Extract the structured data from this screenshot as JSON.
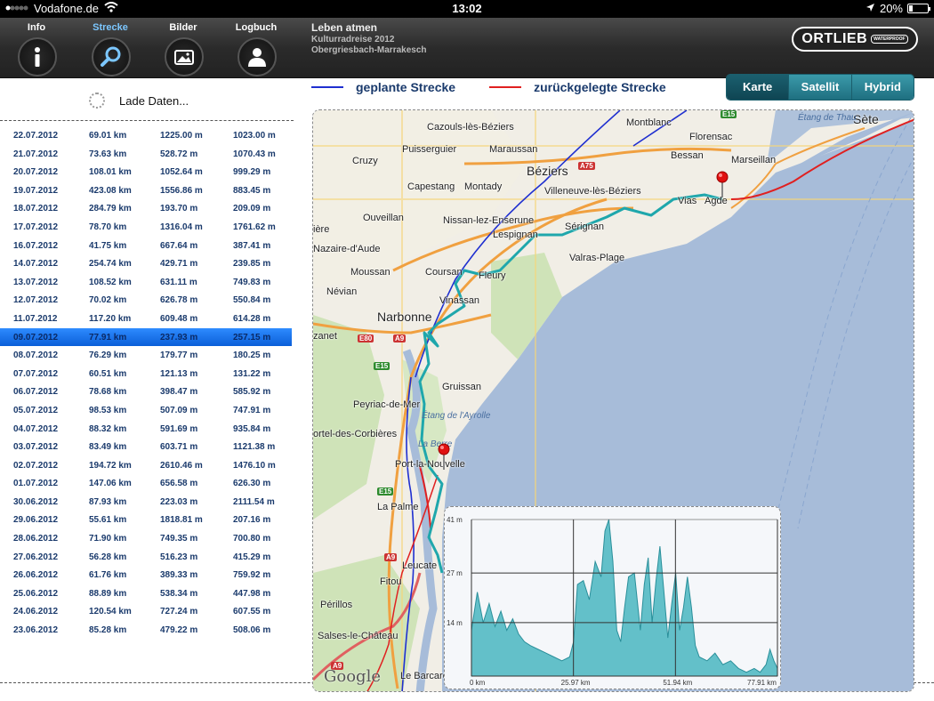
{
  "statusbar": {
    "carrier": "Vodafone.de",
    "time": "13:02",
    "battery": "20%",
    "battery_level": 0.2
  },
  "nav": {
    "tabs": [
      {
        "label": "Info",
        "icon": "info-icon",
        "active": false
      },
      {
        "label": "Strecke",
        "icon": "search-icon",
        "active": true
      },
      {
        "label": "Bilder",
        "icon": "photo-icon",
        "active": false
      },
      {
        "label": "Logbuch",
        "icon": "person-icon",
        "active": false
      }
    ]
  },
  "trip": {
    "title": "Leben atmen",
    "subtitle": "Kulturradreise 2012",
    "route": "Obergriesbach-Marrakesch"
  },
  "logo": {
    "brand": "ORTLIEB",
    "sub": "WATERPROOF"
  },
  "loading": "Lade Daten...",
  "legend": {
    "planned": {
      "label": "geplante Strecke",
      "color": "#1f2fd0"
    },
    "done": {
      "label": "zurückgelegte Strecke",
      "color": "#e02020"
    }
  },
  "maptype": {
    "options": [
      "Karte",
      "Satellit",
      "Hybrid"
    ],
    "selected": "Karte"
  },
  "days": [
    {
      "date": "22.07.2012",
      "dist": "69.01 km",
      "up": "1225.00 m",
      "down": "1023.00 m"
    },
    {
      "date": "21.07.2012",
      "dist": "73.63 km",
      "up": "528.72 m",
      "down": "1070.43 m"
    },
    {
      "date": "20.07.2012",
      "dist": "108.01 km",
      "up": "1052.64 m",
      "down": "999.29 m"
    },
    {
      "date": "19.07.2012",
      "dist": "423.08 km",
      "up": "1556.86 m",
      "down": "883.45 m"
    },
    {
      "date": "18.07.2012",
      "dist": "284.79 km",
      "up": "193.70 m",
      "down": "209.09 m"
    },
    {
      "date": "17.07.2012",
      "dist": "78.70 km",
      "up": "1316.04 m",
      "down": "1761.62 m"
    },
    {
      "date": "16.07.2012",
      "dist": "41.75 km",
      "up": "667.64 m",
      "down": "387.41 m"
    },
    {
      "date": "14.07.2012",
      "dist": "254.74 km",
      "up": "429.71 m",
      "down": "239.85 m"
    },
    {
      "date": "13.07.2012",
      "dist": "108.52 km",
      "up": "631.11 m",
      "down": "749.83 m"
    },
    {
      "date": "12.07.2012",
      "dist": "70.02 km",
      "up": "626.78 m",
      "down": "550.84 m"
    },
    {
      "date": "11.07.2012",
      "dist": "117.20 km",
      "up": "609.48 m",
      "down": "614.28 m"
    },
    {
      "date": "09.07.2012",
      "dist": "77.91 km",
      "up": "237.93 m",
      "down": "257.15 m",
      "selected": true
    },
    {
      "date": "08.07.2012",
      "dist": "76.29 km",
      "up": "179.77 m",
      "down": "180.25 m"
    },
    {
      "date": "07.07.2012",
      "dist": "60.51 km",
      "up": "121.13 m",
      "down": "131.22 m"
    },
    {
      "date": "06.07.2012",
      "dist": "78.68 km",
      "up": "398.47 m",
      "down": "585.92 m"
    },
    {
      "date": "05.07.2012",
      "dist": "98.53 km",
      "up": "507.09 m",
      "down": "747.91 m"
    },
    {
      "date": "04.07.2012",
      "dist": "88.32 km",
      "up": "591.69 m",
      "down": "935.84 m"
    },
    {
      "date": "03.07.2012",
      "dist": "83.49 km",
      "up": "603.71 m",
      "down": "1121.38 m"
    },
    {
      "date": "02.07.2012",
      "dist": "194.72 km",
      "up": "2610.46 m",
      "down": "1476.10 m"
    },
    {
      "date": "01.07.2012",
      "dist": "147.06 km",
      "up": "656.58 m",
      "down": "626.30 m"
    },
    {
      "date": "30.06.2012",
      "dist": "87.93 km",
      "up": "223.03 m",
      "down": "2111.54 m"
    },
    {
      "date": "29.06.2012",
      "dist": "55.61 km",
      "up": "1818.81 m",
      "down": "207.16 m"
    },
    {
      "date": "28.06.2012",
      "dist": "71.90 km",
      "up": "749.35 m",
      "down": "700.80 m"
    },
    {
      "date": "27.06.2012",
      "dist": "56.28 km",
      "up": "516.23 m",
      "down": "415.29 m"
    },
    {
      "date": "26.06.2012",
      "dist": "61.76 km",
      "up": "389.33 m",
      "down": "759.92 m"
    },
    {
      "date": "25.06.2012",
      "dist": "88.89 km",
      "up": "538.34 m",
      "down": "447.98 m"
    },
    {
      "date": "24.06.2012",
      "dist": "120.54 km",
      "up": "727.24 m",
      "down": "607.55 m"
    },
    {
      "date": "23.06.2012",
      "dist": "85.28 km",
      "up": "479.22 m",
      "down": "508.06 m"
    }
  ],
  "map": {
    "places": [
      "Montblanc",
      "Sète",
      "Cazouls-lès-Béziers",
      "Florensac",
      "Puisserguier",
      "Maraussan",
      "Béziers",
      "Bessan",
      "Marseillan",
      "Cruzy",
      "Capestang",
      "Montady",
      "Villeneuve-lès-Béziers",
      "Vias",
      "Agde",
      "Ouveillan",
      "Nissan-lez-Enserune",
      "Sérignan",
      "Lespignan",
      "Nazaire-d'Aude",
      "Valras-Plage",
      "Moussan",
      "Coursan",
      "Fleury",
      "Névian",
      "Vinassan",
      "Narbonne",
      "zanet",
      "Gruissan",
      "Peyriac-de-Mer",
      "ortel-des-Corbières",
      "Port-la-Nouvelle",
      "La Palme",
      "Leucate",
      "Fitou",
      "Périllos",
      "Salses-le-Château",
      "Le Barcarès",
      "ière"
    ],
    "water": [
      "Étang de Thau",
      "Étang de l'Ayrolle",
      "La Berre"
    ],
    "roads": [
      "E15",
      "A75",
      "E80",
      "A9",
      "E15",
      "E15",
      "A9",
      "A9"
    ],
    "attribution": "Google"
  },
  "elevation": {
    "y_ticks": [
      "41 m",
      "27 m",
      "14 m"
    ],
    "x_ticks": [
      "0 km",
      "25.97 km",
      "51.94 km",
      "77.91 km"
    ],
    "chart_data": {
      "type": "area",
      "xlabel": "",
      "ylabel": "",
      "ylim": [
        0,
        41
      ],
      "xlim": [
        0,
        77.91
      ],
      "x": [
        0,
        1.5,
        3,
        4.5,
        6,
        7.5,
        9,
        10.5,
        12,
        13.5,
        15,
        17,
        19,
        21,
        23,
        25,
        26,
        27,
        28.5,
        30,
        31.5,
        33,
        34,
        35,
        36,
        37,
        38,
        39,
        40,
        41.5,
        43,
        44,
        45,
        46,
        47,
        48,
        49,
        50,
        51,
        52,
        53,
        54,
        55,
        56,
        57,
        58,
        60,
        62,
        64,
        66,
        68,
        70,
        72,
        73.5,
        75,
        76,
        77,
        77.91
      ],
      "values": [
        12,
        22,
        14,
        19,
        13,
        17,
        12,
        15,
        11,
        9,
        8,
        7,
        6,
        5,
        4,
        5,
        9,
        24,
        25,
        20,
        30,
        26,
        38,
        42,
        30,
        12,
        9,
        18,
        26,
        27,
        12,
        24,
        31,
        14,
        25,
        34,
        22,
        10,
        19,
        27,
        12,
        18,
        26,
        18,
        8,
        5,
        4,
        6,
        3,
        4,
        2,
        1,
        2,
        1,
        3,
        7,
        4,
        2
      ]
    }
  }
}
